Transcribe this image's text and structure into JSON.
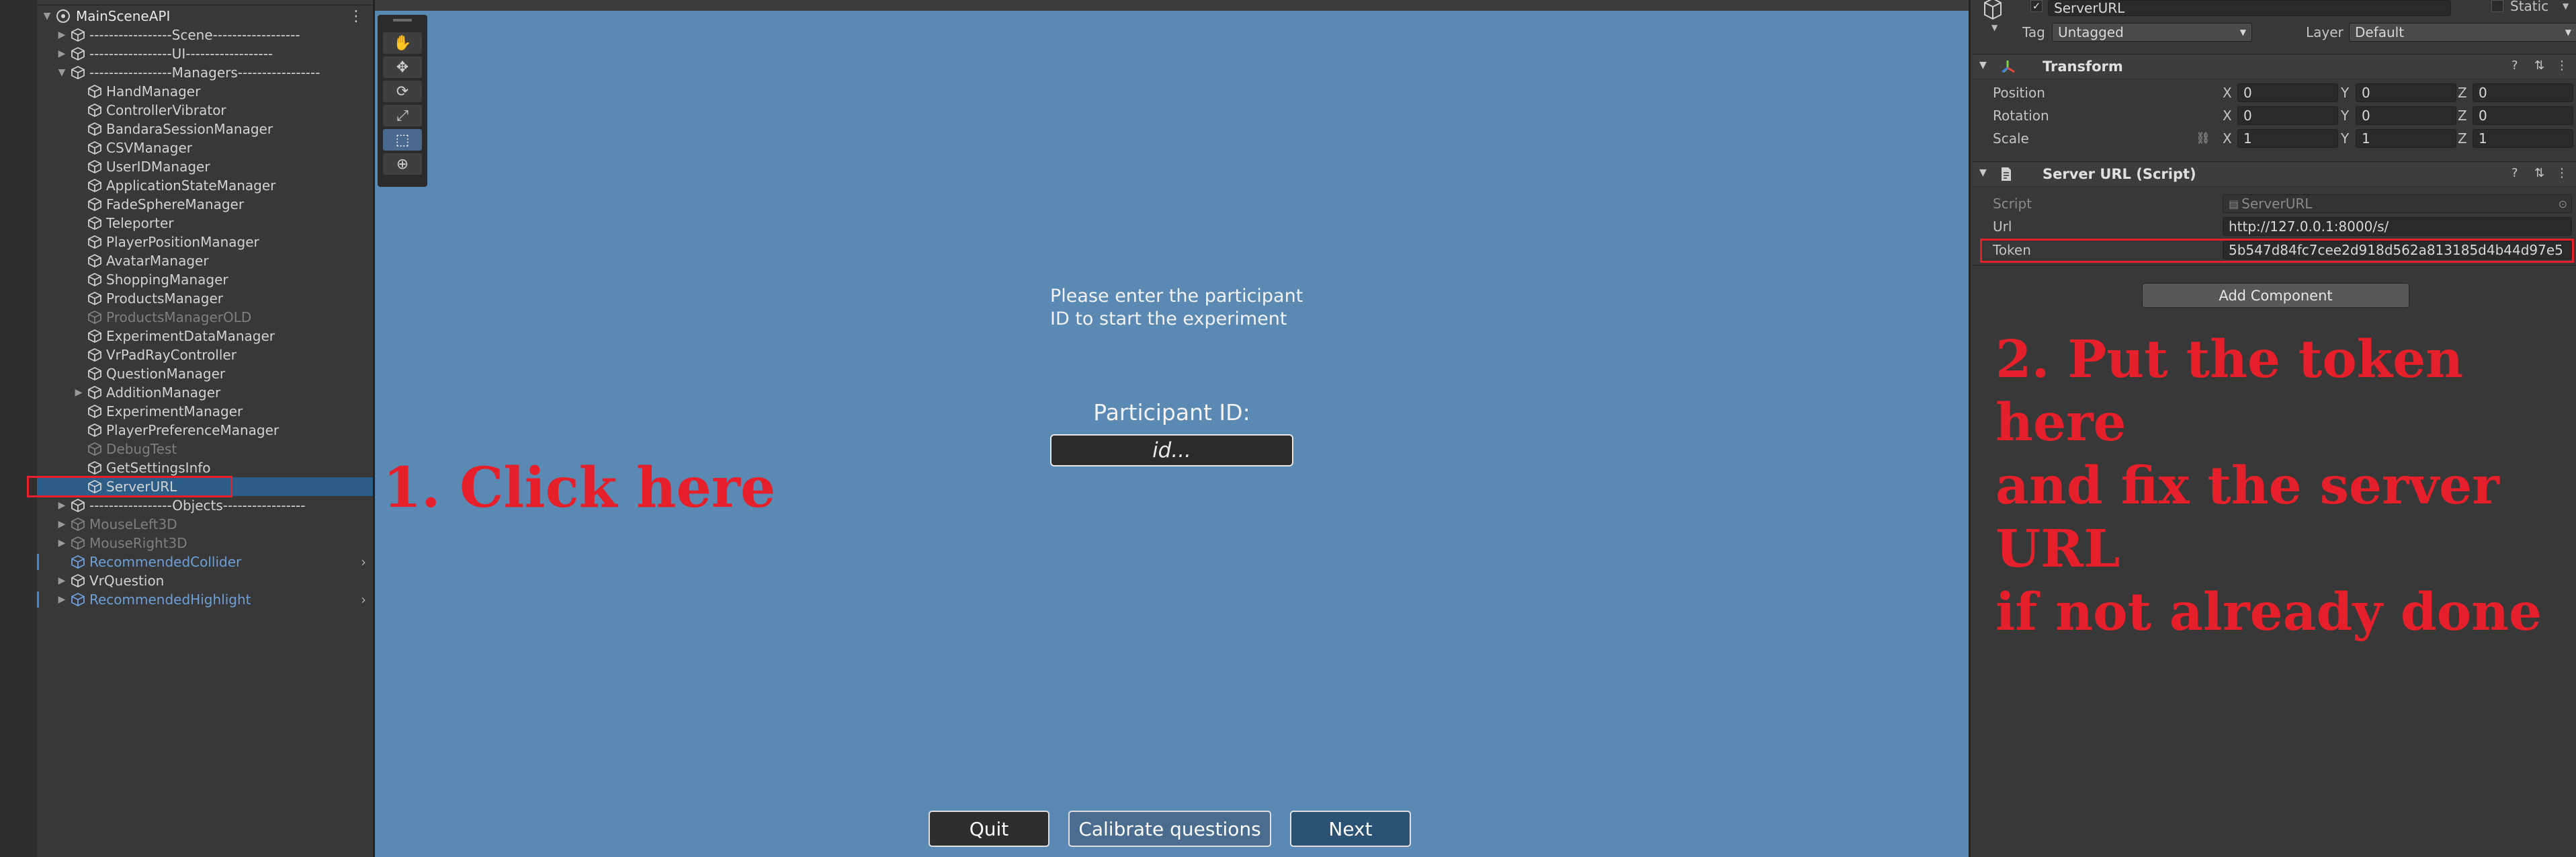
{
  "hierarchy": {
    "scene_name": "MainSceneAPI",
    "items": [
      {
        "label": "-----------------Scene------------------",
        "indent": 1,
        "foldout": "▶",
        "state": "normal"
      },
      {
        "label": "-----------------UI------------------",
        "indent": 1,
        "foldout": "▶",
        "state": "normal"
      },
      {
        "label": "-----------------Managers-----------------",
        "indent": 1,
        "foldout": "▼",
        "state": "normal"
      },
      {
        "label": "HandManager",
        "indent": 2,
        "state": "normal"
      },
      {
        "label": "ControllerVibrator",
        "indent": 2,
        "state": "normal"
      },
      {
        "label": "BandaraSessionManager",
        "indent": 2,
        "state": "normal"
      },
      {
        "label": "CSVManager",
        "indent": 2,
        "state": "normal"
      },
      {
        "label": "UserIDManager",
        "indent": 2,
        "state": "normal"
      },
      {
        "label": "ApplicationStateManager",
        "indent": 2,
        "state": "normal"
      },
      {
        "label": "FadeSphereManager",
        "indent": 2,
        "state": "normal"
      },
      {
        "label": "Teleporter",
        "indent": 2,
        "state": "normal"
      },
      {
        "label": "PlayerPositionManager",
        "indent": 2,
        "state": "normal"
      },
      {
        "label": "AvatarManager",
        "indent": 2,
        "state": "normal"
      },
      {
        "label": "ShoppingManager",
        "indent": 2,
        "state": "normal"
      },
      {
        "label": "ProductsManager",
        "indent": 2,
        "state": "normal"
      },
      {
        "label": "ProductsManagerOLD",
        "indent": 2,
        "state": "disabled"
      },
      {
        "label": "ExperimentDataManager",
        "indent": 2,
        "state": "normal"
      },
      {
        "label": "VrPadRayController",
        "indent": 2,
        "state": "normal"
      },
      {
        "label": "QuestionManager",
        "indent": 2,
        "state": "normal"
      },
      {
        "label": "AdditionManager",
        "indent": 2,
        "foldout": "▶",
        "state": "normal"
      },
      {
        "label": "ExperimentManager",
        "indent": 2,
        "state": "normal"
      },
      {
        "label": "PlayerPreferenceManager",
        "indent": 2,
        "state": "normal"
      },
      {
        "label": "DebugTest",
        "indent": 2,
        "state": "disabled"
      },
      {
        "label": "GetSettingsInfo",
        "indent": 2,
        "state": "normal"
      },
      {
        "label": "ServerURL",
        "indent": 2,
        "state": "selected"
      },
      {
        "label": "-----------------Objects-----------------",
        "indent": 1,
        "foldout": "▶",
        "state": "normal"
      },
      {
        "label": "MouseLeft3D",
        "indent": 1,
        "foldout": "▶",
        "state": "disabled"
      },
      {
        "label": "MouseRight3D",
        "indent": 1,
        "foldout": "▶",
        "state": "disabled"
      },
      {
        "label": "RecommendedCollider",
        "indent": 1,
        "state": "prefab",
        "chevron": "›"
      },
      {
        "label": "VrQuestion",
        "indent": 1,
        "foldout": "▶",
        "state": "normal"
      },
      {
        "label": "RecommendedHighlight",
        "indent": 1,
        "foldout": "▶",
        "state": "prefab",
        "chevron": "›"
      }
    ]
  },
  "scene": {
    "prompt_line1": "Please enter the participant",
    "prompt_line2": "ID to start the experiment",
    "participant_label": "Participant ID:",
    "participant_placeholder": "id...",
    "buttons": {
      "quit": "Quit",
      "calibrate": "Calibrate questions",
      "next": "Next"
    }
  },
  "inspector": {
    "object_name": "ServerURL",
    "static_label": "Static",
    "tag_label": "Tag",
    "tag_value": "Untagged",
    "layer_label": "Layer",
    "layer_value": "Default",
    "transform": {
      "title": "Transform",
      "position_label": "Position",
      "rotation_label": "Rotation",
      "scale_label": "Scale",
      "axis_x": "X",
      "axis_y": "Y",
      "axis_z": "Z",
      "position": {
        "x": "0",
        "y": "0",
        "z": "0"
      },
      "rotation": {
        "x": "0",
        "y": "0",
        "z": "0"
      },
      "scale": {
        "x": "1",
        "y": "1",
        "z": "1"
      }
    },
    "component": {
      "title": "Server URL (Script)",
      "script_label": "Script",
      "script_value": "ServerURL",
      "url_label": "Url",
      "url_value": "http://127.0.0.1:8000/s/",
      "token_label": "Token",
      "token_value": "5b547d84fc7cee2d918d562a813185d4b44d97e5"
    },
    "add_component": "Add Component"
  },
  "annotations": {
    "step1": "1. Click here",
    "step2_line1": "2. Put the token here",
    "step2_line2": "and fix the server URL",
    "step2_line3": "if not already done"
  },
  "colors": {
    "highlight": "#e5202a",
    "selection": "#2c5d87",
    "scene_bg": "#5a8ab3"
  }
}
